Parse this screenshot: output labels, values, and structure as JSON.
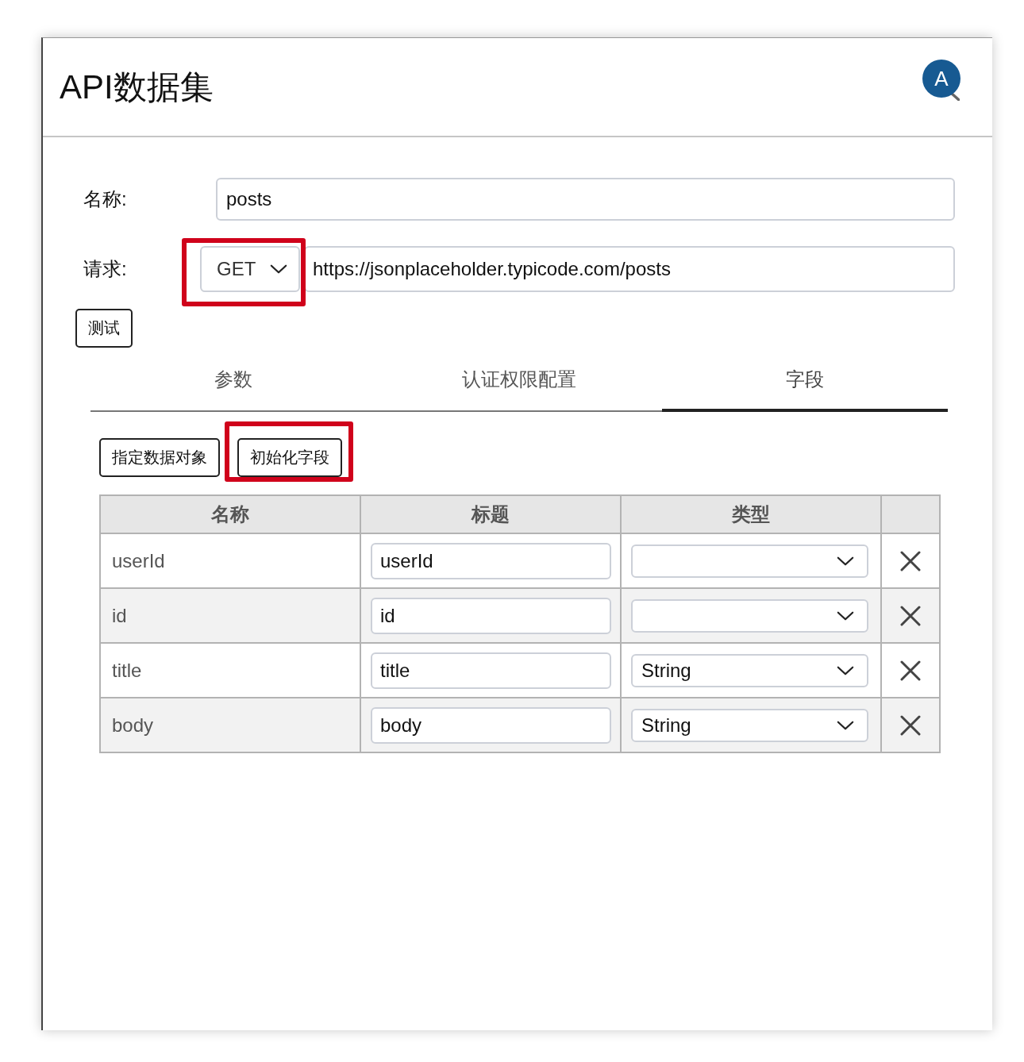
{
  "window": {
    "title": "API数据集",
    "marker": "A"
  },
  "form": {
    "name": {
      "label": "名称:",
      "value": "posts"
    },
    "request": {
      "label": "请求:",
      "method": "GET",
      "method_highlighted": true,
      "url": "https://jsonplaceholder.typicode.com/posts"
    },
    "test_button": "测试"
  },
  "tabs": [
    {
      "label": "参数",
      "selected": false
    },
    {
      "label": "认证权限配置",
      "selected": false
    },
    {
      "label": "字段",
      "selected": true
    }
  ],
  "actions": [
    {
      "label": "指定数据对象",
      "highlighted": false
    },
    {
      "label": "初始化字段",
      "highlighted": true
    }
  ],
  "table": {
    "columns": [
      "名称",
      "标题",
      "类型"
    ],
    "rows": [
      {
        "name": "userId",
        "title": "userId"
      },
      {
        "name": "id",
        "title": "id"
      },
      {
        "name": "title",
        "title": "title",
        "type": "String"
      },
      {
        "name": "body",
        "title": "body",
        "type": "String"
      }
    ]
  }
}
